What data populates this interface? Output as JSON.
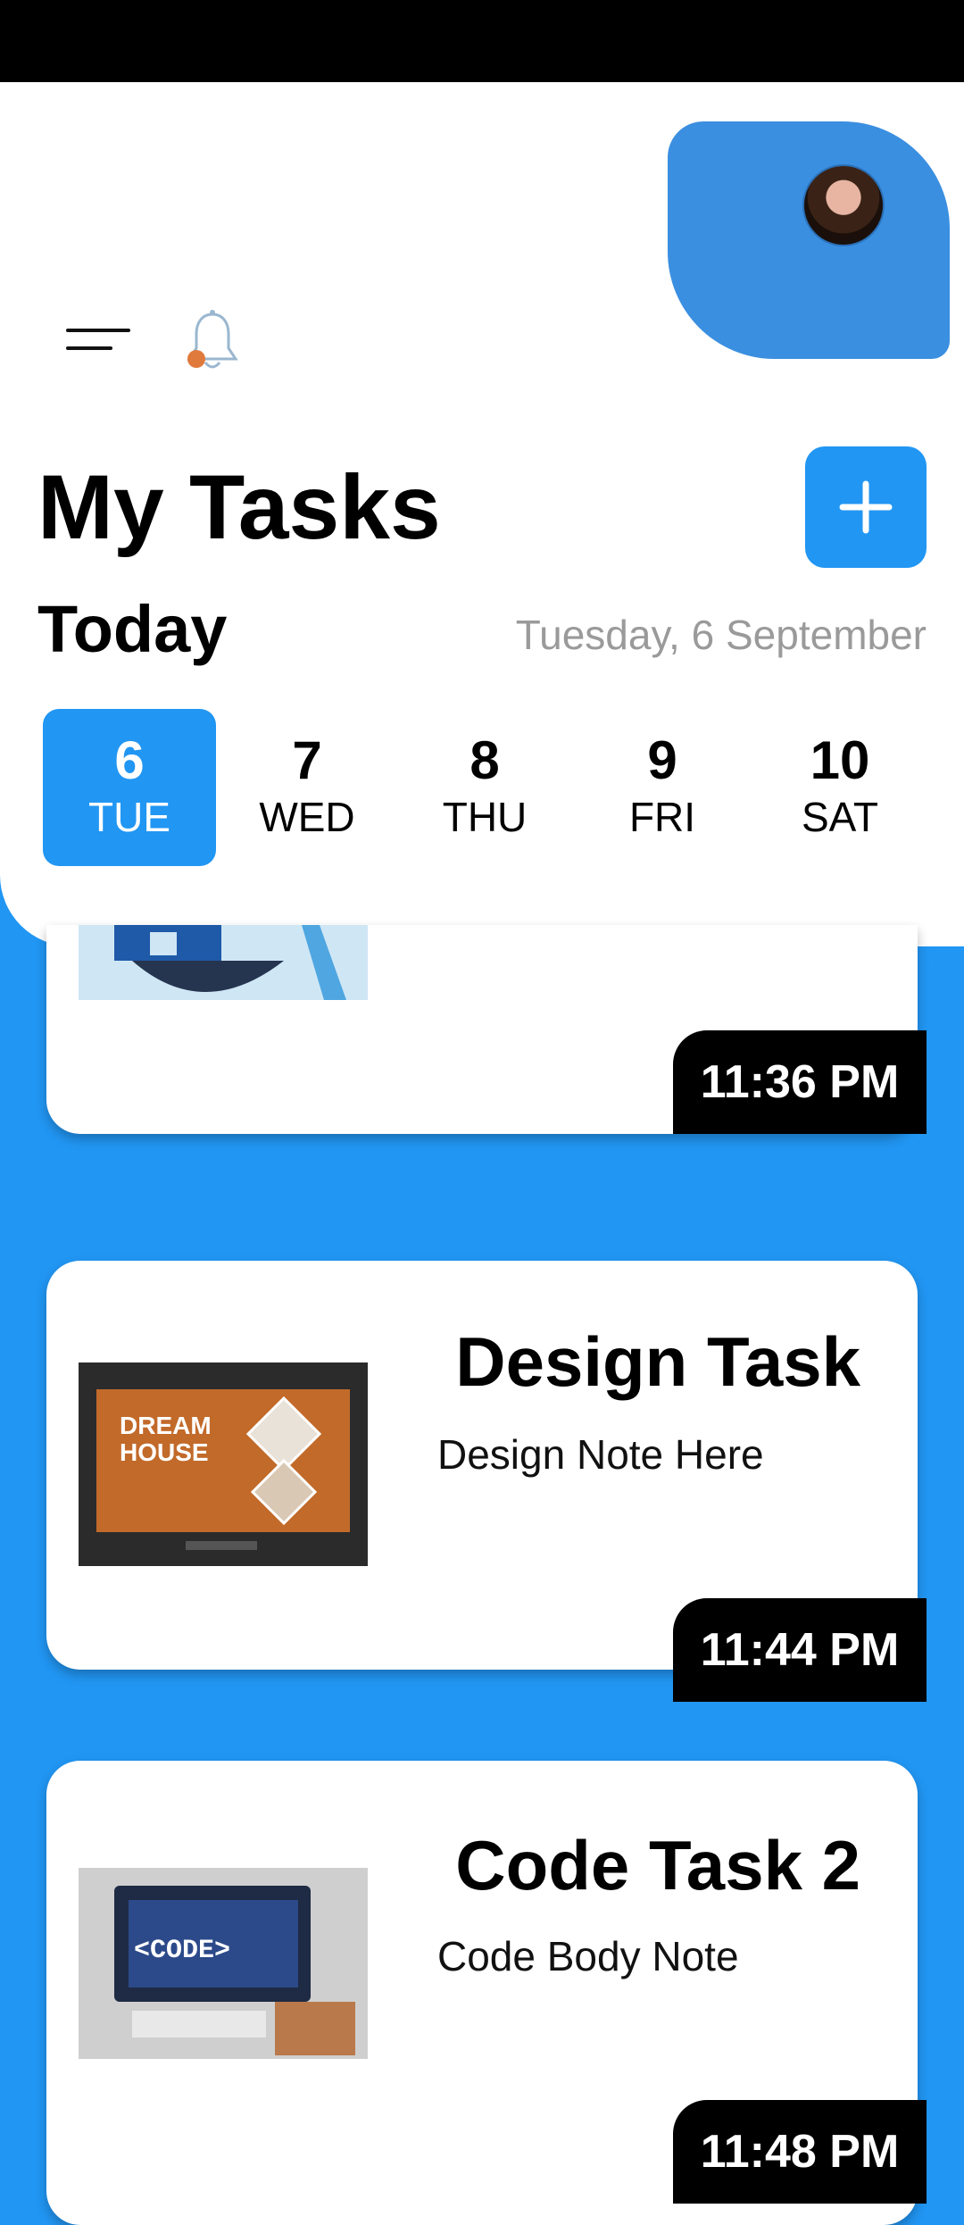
{
  "header": {
    "title": "My Tasks",
    "today_label": "Today",
    "date_text": "Tuesday, 6 September",
    "add_label": "+"
  },
  "days": [
    {
      "num": "6",
      "weekday": "TUE",
      "selected": true
    },
    {
      "num": "7",
      "weekday": "WED",
      "selected": false
    },
    {
      "num": "8",
      "weekday": "THU",
      "selected": false
    },
    {
      "num": "9",
      "weekday": "FRI",
      "selected": false
    },
    {
      "num": "10",
      "weekday": "SAT",
      "selected": false
    }
  ],
  "tasks": [
    {
      "title": "",
      "note": "",
      "time": "11:36 PM",
      "image": "house-illustration"
    },
    {
      "title": "Design Task",
      "note": "Design Note Here",
      "time": "11:44 PM",
      "image": "dream-house-design-preview"
    },
    {
      "title": "Code Task 2",
      "note": "Code Body Note",
      "time": "11:48 PM",
      "image": "code-laptop-photo"
    }
  ],
  "colors": {
    "accent": "#2196F3",
    "time_badge": "#000000",
    "muted_text": "#9a9a9a"
  },
  "icons": {
    "menu": "menu-icon",
    "notifications": "bell-icon",
    "profile": "avatar"
  }
}
